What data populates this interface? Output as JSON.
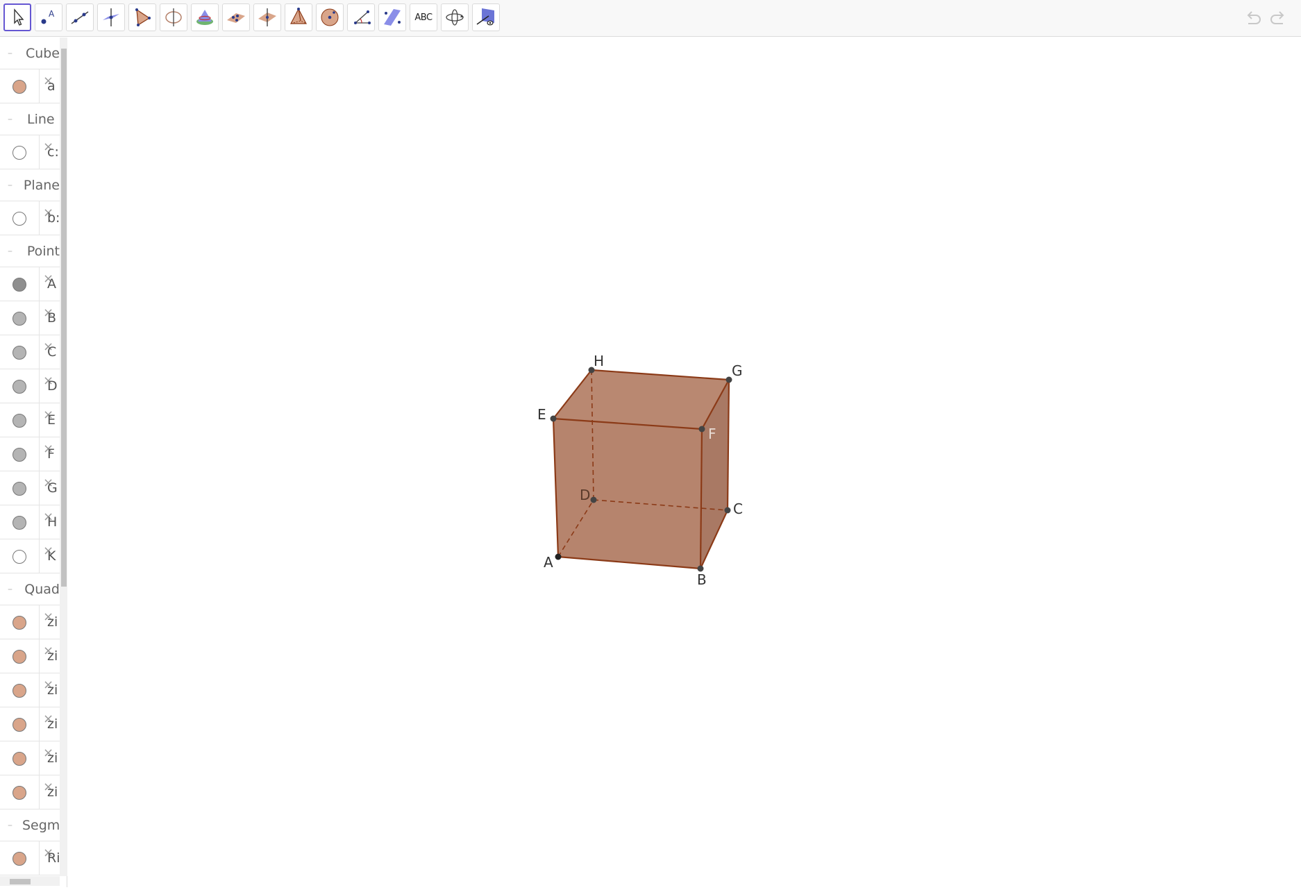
{
  "toolbar": {
    "tools": [
      {
        "name": "move-tool-icon",
        "selected": true
      },
      {
        "name": "point-tool-icon"
      },
      {
        "name": "line-tool-icon"
      },
      {
        "name": "perpendicular-line-tool-icon"
      },
      {
        "name": "polygon-tool-icon"
      },
      {
        "name": "circle-around-line-tool-icon"
      },
      {
        "name": "intersect-surfaces-tool-icon"
      },
      {
        "name": "plane-through-points-tool-icon"
      },
      {
        "name": "perpendicular-plane-tool-icon"
      },
      {
        "name": "pyramid-tool-icon"
      },
      {
        "name": "sphere-tool-icon"
      },
      {
        "name": "angle-tool-icon"
      },
      {
        "name": "reflect-tool-icon"
      },
      {
        "name": "text-tool-icon",
        "label": "ABC"
      },
      {
        "name": "rotate-view-tool-icon"
      },
      {
        "name": "view-in-front-of-tool-icon"
      }
    ]
  },
  "algebra": {
    "groups": [
      {
        "label": "Cube",
        "items": [
          {
            "name": "a",
            "color": "#d9a58a"
          }
        ]
      },
      {
        "label": "Line",
        "items": [
          {
            "name": "c:",
            "color": "#ffffff"
          }
        ]
      },
      {
        "label": "Plane",
        "items": [
          {
            "name": "b:",
            "color": "#ffffff"
          }
        ]
      },
      {
        "label": "Point",
        "items": [
          {
            "name": "A",
            "color": "#8f8f8f"
          },
          {
            "name": "B",
            "color": "#b4b4b4"
          },
          {
            "name": "C",
            "color": "#b4b4b4"
          },
          {
            "name": "D",
            "color": "#b4b4b4"
          },
          {
            "name": "E",
            "color": "#b4b4b4"
          },
          {
            "name": "F",
            "color": "#b4b4b4"
          },
          {
            "name": "G",
            "color": "#b4b4b4"
          },
          {
            "name": "H",
            "color": "#b4b4b4"
          },
          {
            "name": "K",
            "color": "#ffffff"
          }
        ]
      },
      {
        "label": "Quad",
        "items": [
          {
            "name": "zi",
            "color": "#d9a58a"
          },
          {
            "name": "zi",
            "color": "#d9a58a"
          },
          {
            "name": "zi",
            "color": "#d9a58a"
          },
          {
            "name": "zi",
            "color": "#d9a58a"
          },
          {
            "name": "zi",
            "color": "#d9a58a"
          },
          {
            "name": "zi",
            "color": "#d9a58a"
          }
        ]
      },
      {
        "label": "Segm",
        "items": [
          {
            "name": "Ri",
            "color": "#d9a58a"
          }
        ]
      }
    ]
  },
  "view3d": {
    "cube_color": "#b5826b",
    "edge_color": "#8b3a17",
    "vertex_labels": [
      "A",
      "B",
      "C",
      "D",
      "E",
      "F",
      "G",
      "H"
    ]
  }
}
